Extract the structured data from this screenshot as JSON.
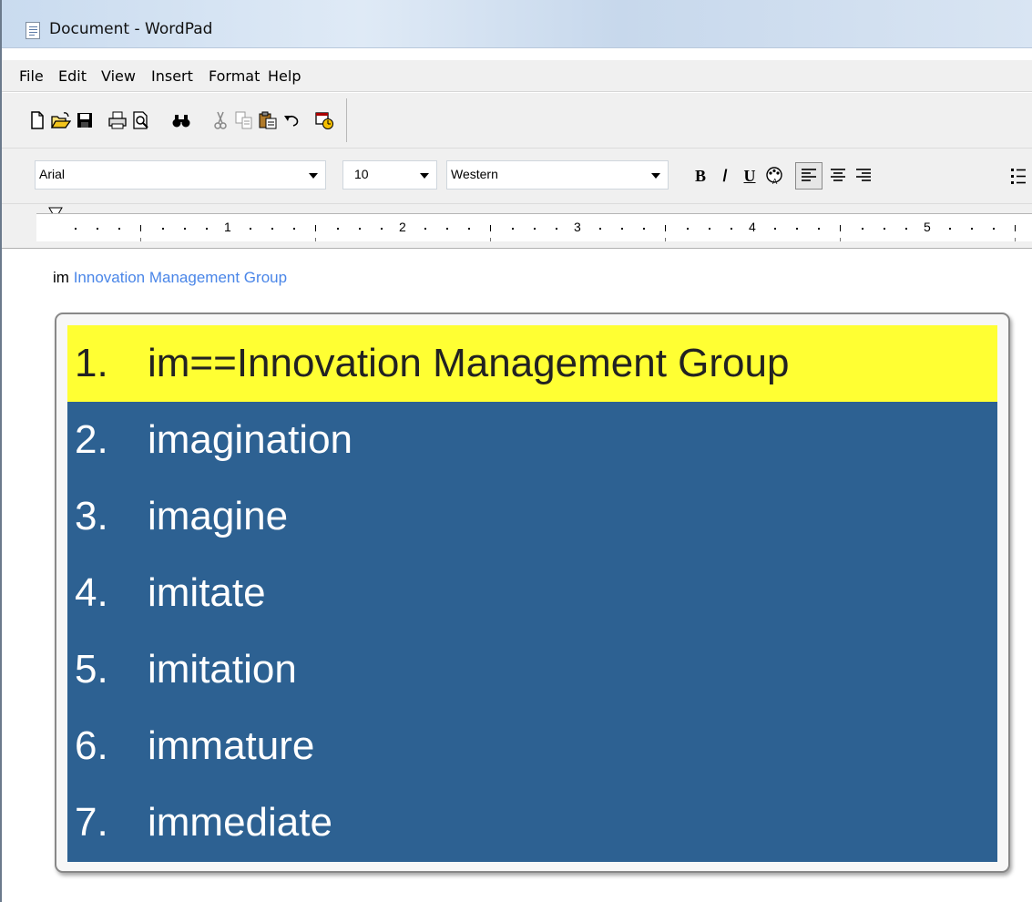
{
  "window": {
    "title": "Document - WordPad"
  },
  "menu": [
    "File",
    "Edit",
    "View",
    "Insert",
    "Format",
    "Help"
  ],
  "toolbar": {
    "icons": [
      "new-icon",
      "open-icon",
      "save-icon",
      "print-icon",
      "print-preview-icon",
      "find-icon",
      "cut-icon",
      "copy-icon",
      "paste-icon",
      "undo-icon",
      "date-time-icon"
    ]
  },
  "format_bar": {
    "font": "Arial",
    "size": "10",
    "script": "Western",
    "bold": "B",
    "italic": "/",
    "underline": "U"
  },
  "ruler": {
    "numbers": [
      "1",
      "2",
      "3",
      "4",
      "5"
    ]
  },
  "document": {
    "typed": "im",
    "suggestion": "Innovation Management Group"
  },
  "autocomplete": {
    "selected_index": 0,
    "colors": {
      "list_bg": "#2d6192",
      "selected_bg": "#ffff33"
    },
    "items": [
      {
        "num": "1.",
        "text": "im==Innovation Management Group"
      },
      {
        "num": "2.",
        "text": "imagination"
      },
      {
        "num": "3.",
        "text": "imagine"
      },
      {
        "num": "4.",
        "text": "imitate"
      },
      {
        "num": "5.",
        "text": "imitation"
      },
      {
        "num": "6.",
        "text": "immature"
      },
      {
        "num": "7.",
        "text": "immediate"
      }
    ]
  }
}
